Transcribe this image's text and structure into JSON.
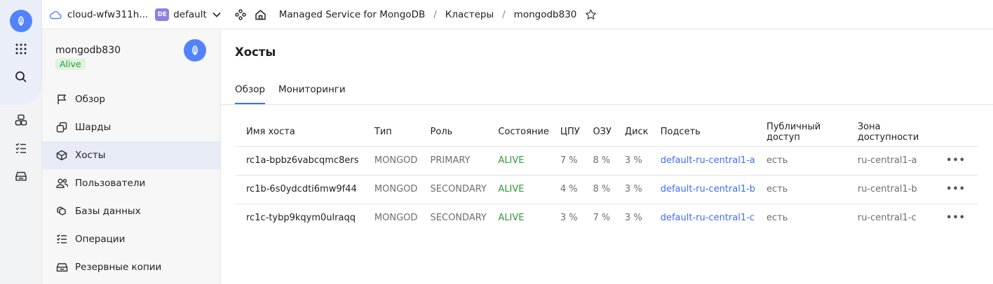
{
  "header": {
    "cloud": "cloud-wfw311h...",
    "folder_badge": "DE",
    "folder": "default",
    "service": "Managed Service for MongoDB",
    "section": "Кластеры",
    "cluster": "mongodb830",
    "separator": "/"
  },
  "sidebar": {
    "cluster_name": "mongodb830",
    "status": "Alive",
    "items": [
      {
        "label": "Обзор",
        "icon": "flag-icon"
      },
      {
        "label": "Шарды",
        "icon": "shards-icon"
      },
      {
        "label": "Хосты",
        "icon": "cube-icon",
        "active": true
      },
      {
        "label": "Пользователи",
        "icon": "users-icon"
      },
      {
        "label": "Базы данных",
        "icon": "databases-icon"
      },
      {
        "label": "Операции",
        "icon": "list-check-icon"
      },
      {
        "label": "Резервные копии",
        "icon": "backup-icon"
      }
    ]
  },
  "main": {
    "title": "Хосты",
    "tabs": [
      {
        "label": "Обзор",
        "active": true
      },
      {
        "label": "Мониторинги",
        "active": false
      }
    ],
    "columns": [
      "Имя хоста",
      "Тип",
      "Роль",
      "Состояние",
      "ЦПУ",
      "ОЗУ",
      "Диск",
      "Подсеть",
      "Публичный доступ",
      "Зона доступности"
    ],
    "rows": [
      {
        "host": "rc1a-bpbz6vabcqmc8ers",
        "type": "MONGOD",
        "role": "PRIMARY",
        "state": "ALIVE",
        "cpu": "7 %",
        "ram": "8 %",
        "disk": "3 %",
        "subnet": "default-ru-central1-a",
        "public": "есть",
        "zone": "ru-central1-a"
      },
      {
        "host": "rc1b-6s0ydcdti6mw9f44",
        "type": "MONGOD",
        "role": "SECONDARY",
        "state": "ALIVE",
        "cpu": "4 %",
        "ram": "8 %",
        "disk": "3 %",
        "subnet": "default-ru-central1-b",
        "public": "есть",
        "zone": "ru-central1-b"
      },
      {
        "host": "rc1c-tybp9kqym0ulraqq",
        "type": "MONGOD",
        "role": "SECONDARY",
        "state": "ALIVE",
        "cpu": "3 %",
        "ram": "7 %",
        "disk": "3 %",
        "subnet": "default-ru-central1-c",
        "public": "есть",
        "zone": "ru-central1-c"
      }
    ],
    "row_menu": "•••"
  },
  "colors": {
    "accent": "#3d6dfb",
    "alive": "#2b9a37",
    "logo": "#5282ff"
  }
}
